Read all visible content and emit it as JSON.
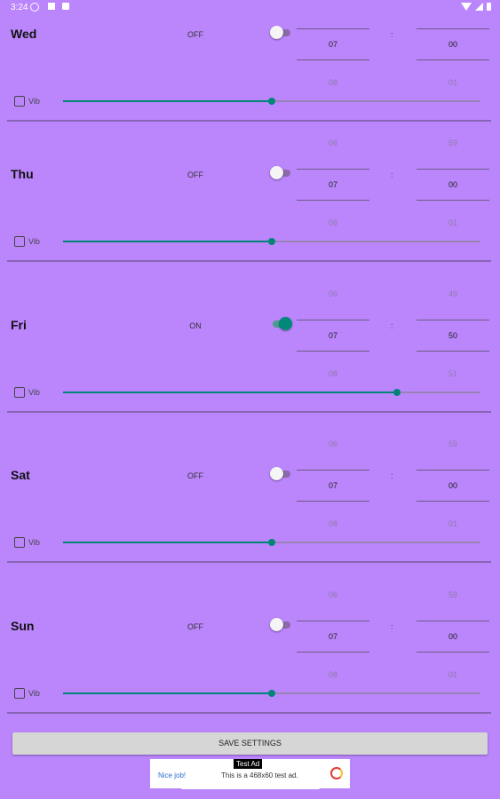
{
  "status_bar": {
    "time": "3:24",
    "left_icons": [
      "vpn-icon",
      "notification-icon",
      "sd-card-icon"
    ],
    "right_icons": [
      "wifi-icon",
      "cellular-icon",
      "battery-icon"
    ]
  },
  "days": [
    {
      "name": "Wed",
      "state": "OFF",
      "enabled": false,
      "hour": {
        "prev": "",
        "current": "07",
        "next": "08"
      },
      "minute": {
        "prev": "",
        "current": "00",
        "next": "01"
      },
      "separator": ":",
      "vib_label": "Vib",
      "vib_checked": false,
      "volume_fraction": 0.5
    },
    {
      "name": "Thu",
      "state": "OFF",
      "enabled": false,
      "hour": {
        "prev": "06",
        "current": "07",
        "next": "08"
      },
      "minute": {
        "prev": "59",
        "current": "00",
        "next": "01"
      },
      "separator": ":",
      "vib_label": "Vib",
      "vib_checked": false,
      "volume_fraction": 0.5
    },
    {
      "name": "Fri",
      "state": "ON",
      "enabled": true,
      "hour": {
        "prev": "06",
        "current": "07",
        "next": "08"
      },
      "minute": {
        "prev": "49",
        "current": "50",
        "next": "51"
      },
      "separator": ":",
      "vib_label": "Vib",
      "vib_checked": false,
      "volume_fraction": 0.8
    },
    {
      "name": "Sat",
      "state": "OFF",
      "enabled": false,
      "hour": {
        "prev": "06",
        "current": "07",
        "next": "08"
      },
      "minute": {
        "prev": "59",
        "current": "00",
        "next": "01"
      },
      "separator": ":",
      "vib_label": "Vib",
      "vib_checked": false,
      "volume_fraction": 0.5
    },
    {
      "name": "Sun",
      "state": "OFF",
      "enabled": false,
      "hour": {
        "prev": "06",
        "current": "07",
        "next": "08"
      },
      "minute": {
        "prev": "59",
        "current": "00",
        "next": "01"
      },
      "separator": ":",
      "vib_label": "Vib",
      "vib_checked": false,
      "volume_fraction": 0.5
    }
  ],
  "save_button": {
    "label": "SAVE SETTINGS"
  },
  "ad": {
    "badge": "Test Ad",
    "cta": "Nice job!",
    "text": "This is a 468x60 test ad."
  },
  "colors": {
    "background": "#bb86fc",
    "accent": "#008577"
  }
}
